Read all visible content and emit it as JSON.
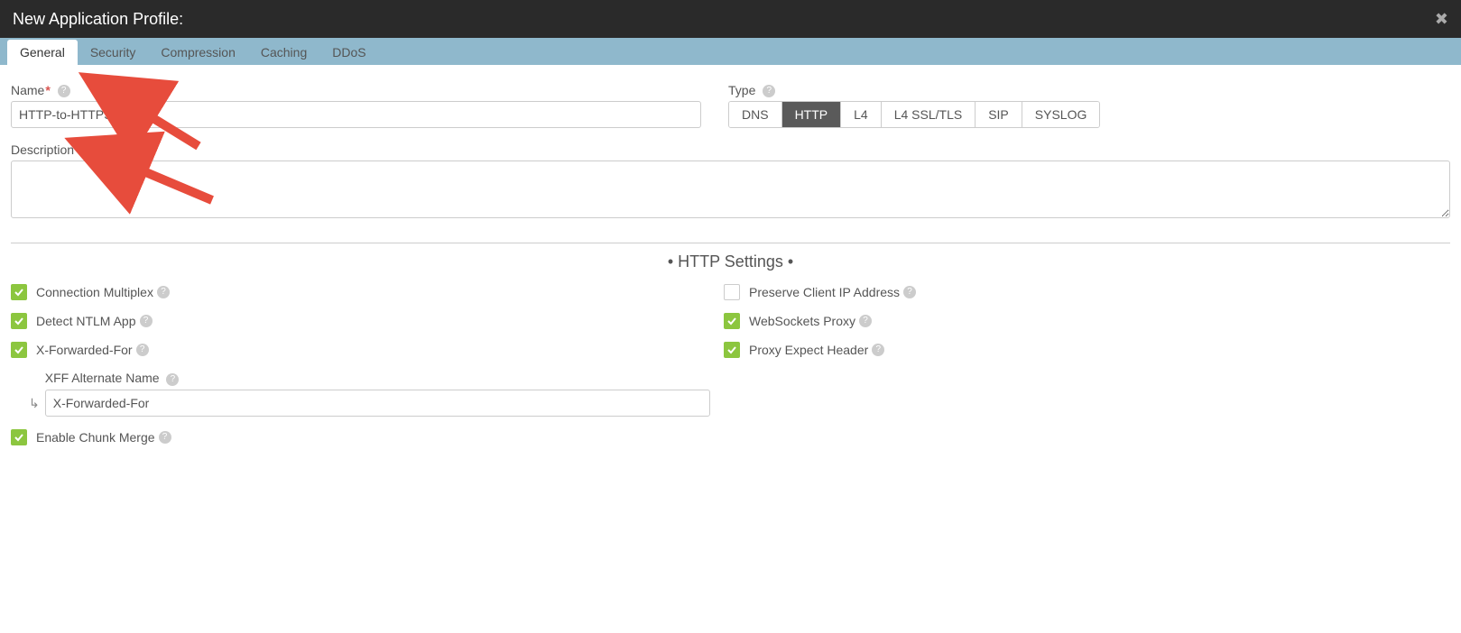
{
  "header": {
    "title": "New Application Profile:"
  },
  "tabs": [
    {
      "label": "General",
      "active": true
    },
    {
      "label": "Security",
      "active": false
    },
    {
      "label": "Compression",
      "active": false
    },
    {
      "label": "Caching",
      "active": false
    },
    {
      "label": "DDoS",
      "active": false
    }
  ],
  "form": {
    "name_label": "Name",
    "name_value": "HTTP-to-HTTPS",
    "type_label": "Type",
    "type_options": [
      {
        "label": "DNS",
        "active": false
      },
      {
        "label": "HTTP",
        "active": true
      },
      {
        "label": "L4",
        "active": false
      },
      {
        "label": "L4 SSL/TLS",
        "active": false
      },
      {
        "label": "SIP",
        "active": false
      },
      {
        "label": "SYSLOG",
        "active": false
      }
    ],
    "description_label": "Description",
    "description_value": ""
  },
  "section_title": "• HTTP Settings •",
  "settings_left": [
    {
      "label": "Connection Multiplex",
      "checked": true
    },
    {
      "label": "Detect NTLM App",
      "checked": true
    },
    {
      "label": "X-Forwarded-For",
      "checked": true
    }
  ],
  "xff_sub": {
    "label": "XFF Alternate Name",
    "value": "X-Forwarded-For"
  },
  "settings_left2": [
    {
      "label": "Enable Chunk Merge",
      "checked": true
    }
  ],
  "settings_right": [
    {
      "label": "Preserve Client IP Address",
      "checked": false
    },
    {
      "label": "WebSockets Proxy",
      "checked": true
    },
    {
      "label": "Proxy Expect Header",
      "checked": true
    }
  ]
}
